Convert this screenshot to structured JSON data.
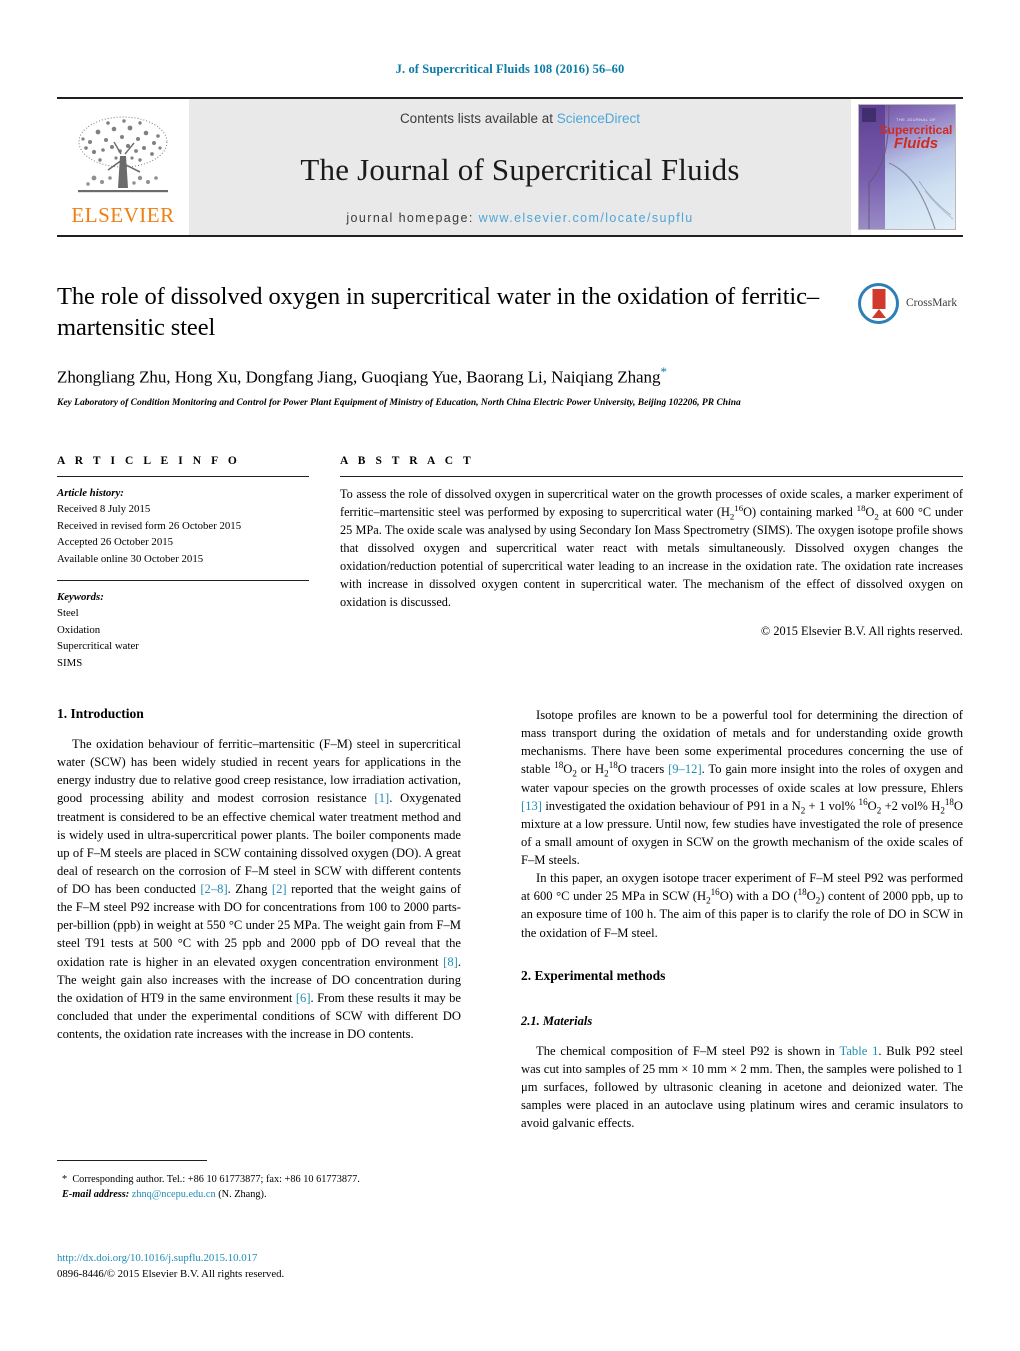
{
  "running_head": "J. of Supercritical Fluids 108 (2016) 56–60",
  "masthead": {
    "elsevier_wordmark": "ELSEVIER",
    "contents_prefix": "Contents lists available at ",
    "contents_link": "ScienceDirect",
    "journal_name": "The Journal of Supercritical Fluids",
    "homepage_prefix": "journal homepage: ",
    "homepage_url": "www.elsevier.com/locate/supflu",
    "cover": {
      "line_top": "THE JOURNAL OF",
      "line_1": "Supercritical",
      "line_2": "Fluids"
    },
    "accent_link_color": "#4ea6d8",
    "elsevier_orange": "#f07f13"
  },
  "article": {
    "title": "The role of dissolved oxygen in supercritical water in the oxidation of ferritic–martensitic steel",
    "authors": "Zhongliang Zhu, Hong Xu, Dongfang Jiang, Guoqiang Yue, Baorang Li, Naiqiang Zhang",
    "corresponding_marker": "*",
    "affiliation": "Key Laboratory of Condition Monitoring and Control for Power Plant Equipment of Ministry of Education, North China Electric Power University, Beijing 102206, PR China",
    "crossmark_label": "CrossMark"
  },
  "article_info": {
    "heading": "A R T I C L E    I N F O",
    "history_label": "Article history:",
    "history": [
      "Received 8 July 2015",
      "Received in revised form 26 October 2015",
      "Accepted 26 October 2015",
      "Available online 30 October 2015"
    ],
    "keywords_label": "Keywords:",
    "keywords": [
      "Steel",
      "Oxidation",
      "Supercritical water",
      "SIMS"
    ]
  },
  "abstract": {
    "heading": "A B S T R A C T",
    "text_1": "To assess the role of dissolved oxygen in supercritical water on the growth processes of oxide scales, a marker experiment of ferritic–martensitic steel was performed by exposing to supercritical water (H",
    "h2_sub": "2",
    "o16_sup": "16",
    "text_2": "O) containing marked ",
    "o18_sup": "18",
    "o2_sub": "2",
    "text_3": " at 600 °C under 25 MPa. The oxide scale was analysed by using Secondary Ion Mass Spectrometry (SIMS). The oxygen isotope profile shows that dissolved oxygen and supercritical water react with metals simultaneously. Dissolved oxygen changes the oxidation/reduction potential of supercritical water leading to an increase in the oxidation rate. The oxidation rate increases with increase in dissolved oxygen content in supercritical water. The mechanism of the effect of dissolved oxygen on oxidation is discussed.",
    "copyright": "© 2015 Elsevier B.V. All rights reserved."
  },
  "sections": {
    "introduction_heading": "1.  Introduction",
    "experimental_heading": "2.  Experimental methods",
    "materials_heading": "2.1.  Materials"
  },
  "left_column": {
    "p1_a": "The oxidation behaviour of ferritic–martensitic (F–M) steel in supercritical water (SCW) has been widely studied in recent years for applications in the energy industry due to relative good creep resistance, low irradiation activation, good processing ability and modest corrosion resistance ",
    "ref1": "[1]",
    "p1_b": ". Oxygenated treatment is considered to be an effective chemical water treatment method and is widely used in ultra-supercritical power plants. The boiler components made up of F–M steels are placed in SCW containing dissolved oxygen (DO). A great deal of research on the corrosion of F–M steel in SCW with different contents of DO has been conducted ",
    "ref2": "[2–8]",
    "p1_c": ". Zhang ",
    "ref3": "[2]",
    "p1_d": " reported that the weight gains of the F–M steel P92 increase with DO for concentrations from 100 to 2000 parts-per-billion (ppb) in weight at 550 °C under 25 MPa. The weight gain from F–M steel T91 tests at 500 °C with 25 ppb and 2000 ppb of DO reveal that the oxidation rate is higher in an elevated oxygen concentration environment ",
    "ref4": "[8]",
    "p1_e": ". The weight gain also increases with the increase of DO concentration during the oxidation of HT9 in the same environment ",
    "ref5": "[6]",
    "p1_f": ". From these results it may be concluded that under the experimental conditions of SCW with different DO contents, the oxidation rate increases with the increase in DO contents."
  },
  "right_column": {
    "p1_a": "Isotope profiles are known to be a powerful tool for determining the direction of mass transport during the oxidation of metals and for understanding oxide growth mechanisms. There have been some experimental procedures concerning the use of stable ",
    "sup18_a": "18",
    "p1_b": "O",
    "sub2_a": "2",
    "p1_c": " or H",
    "sub2_b": "2",
    "sup18_b": "18",
    "p1_d": "O tracers ",
    "ref9": "[9–12]",
    "p1_e": ". To gain more insight into the roles of oxygen and water vapour species on the growth processes of oxide scales at low pressure, Ehlers ",
    "ref13": "[13]",
    "p1_f": " investigated the oxidation behaviour of P91 in a N",
    "sub2_c": "2",
    "p1_g": " + 1 vol% ",
    "sup16_a": "16",
    "p1_h": "O",
    "sub2_d": "2",
    "p1_i": " +2 vol% H",
    "sub2_e": "2",
    "sup18_c": "18",
    "p1_j": "O mixture at a low pressure. Until now, few studies have investigated the role of presence of a small amount of oxygen in SCW on the growth mechanism of the oxide scales of F–M steels.",
    "p2_a": "In this paper, an oxygen isotope tracer experiment of F–M steel P92 was performed at 600 °C under 25 MPa in SCW (H",
    "sub2_f": "2",
    "sup16_b": "16",
    "p2_b": "O) with a DO (",
    "sup18_d": "18",
    "p2_c": "O",
    "sub2_g": "2",
    "p2_d": ") content of 2000 ppb, up to an exposure time of 100 h. The aim of this paper is to clarify the role of DO in SCW in the oxidation of F–M steel.",
    "p3_a": "The chemical composition of F–M steel P92 is shown in ",
    "table_link": "Table 1",
    "p3_b": ". Bulk P92 steel was cut into samples of 25 mm × 10 mm × 2 mm. Then, the samples were polished to 1 μm surfaces, followed by ultrasonic cleaning in acetone and deionized water. The samples were placed in an autoclave using platinum wires and ceramic insulators to avoid galvanic effects."
  },
  "footnote": {
    "marker": "*",
    "text": "Corresponding author. Tel.: +86 10 61773877; fax: +86 10 61773877.",
    "email_label": "E-mail address:",
    "email": "zhnq@ncepu.edu.cn",
    "email_owner": "(N. Zhang)."
  },
  "footer": {
    "doi": "http://dx.doi.org/10.1016/j.supflu.2015.10.017",
    "issn_line": "0896-8446/© 2015 Elsevier B.V. All rights reserved."
  }
}
